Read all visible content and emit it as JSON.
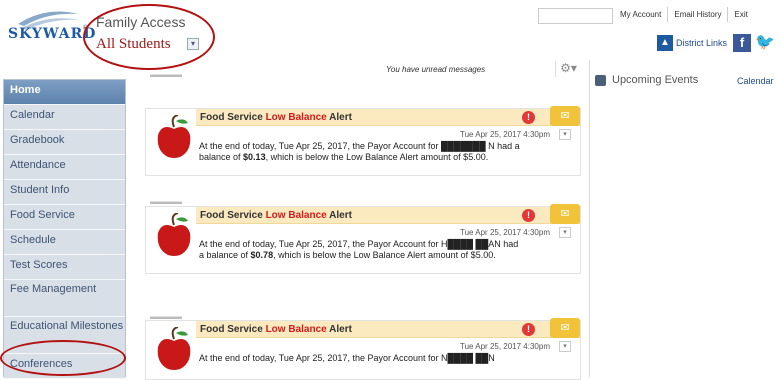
{
  "header": {
    "logo_text": "SKYWARD",
    "app_title": "Family Access",
    "student_selector": "All Students",
    "top_links": [
      "My Account",
      "Email History",
      "Exit"
    ],
    "district_links": "District Links"
  },
  "sidebar": {
    "items": [
      {
        "label": "Home",
        "active": true
      },
      {
        "label": "Calendar"
      },
      {
        "label": "Gradebook"
      },
      {
        "label": "Attendance"
      },
      {
        "label": "Student Info"
      },
      {
        "label": "Food Service"
      },
      {
        "label": "Schedule"
      },
      {
        "label": "Test Scores"
      },
      {
        "label": "Fee Management"
      },
      {
        "label": "Educational Milestones"
      },
      {
        "label": "Conferences"
      }
    ]
  },
  "feed": {
    "unread_text": "You have unread messages",
    "cards": [
      {
        "title_pre": "Food Service ",
        "title_low": "Low Balance",
        "title_post": " Alert",
        "timestamp": "Tue Apr 25, 2017 4:30pm",
        "body": "At the end of today, Tue Apr 25, 2017, the Payor Account for ███████ N had a balance of $0.13, which is below the Low Balance Alert amount of $5.00."
      },
      {
        "title_pre": "Food Service ",
        "title_low": "Low Balance",
        "title_post": " Alert",
        "timestamp": "Tue Apr 25, 2017 4:30pm",
        "body": "At the end of today, Tue Apr 25, 2017, the Payor Account for H████ ██AN had a balance of $0.78, which is below the Low Balance Alert amount of $5.00."
      },
      {
        "title_pre": "Food Service ",
        "title_low": "Low Balance",
        "title_post": " Alert",
        "timestamp": "Tue Apr 25, 2017 4:30pm",
        "body": "At the end of today, Tue Apr 25, 2017, the Payor Account for N████ ██N"
      }
    ]
  },
  "events": {
    "title": "Upcoming Events",
    "calendar_link": "Calendar"
  },
  "colors": {
    "alert_red": "#d01c1c",
    "sidebar_active": "#6b8db5",
    "card_header": "#fbe9bf",
    "annotation_circle": "#b31111"
  }
}
